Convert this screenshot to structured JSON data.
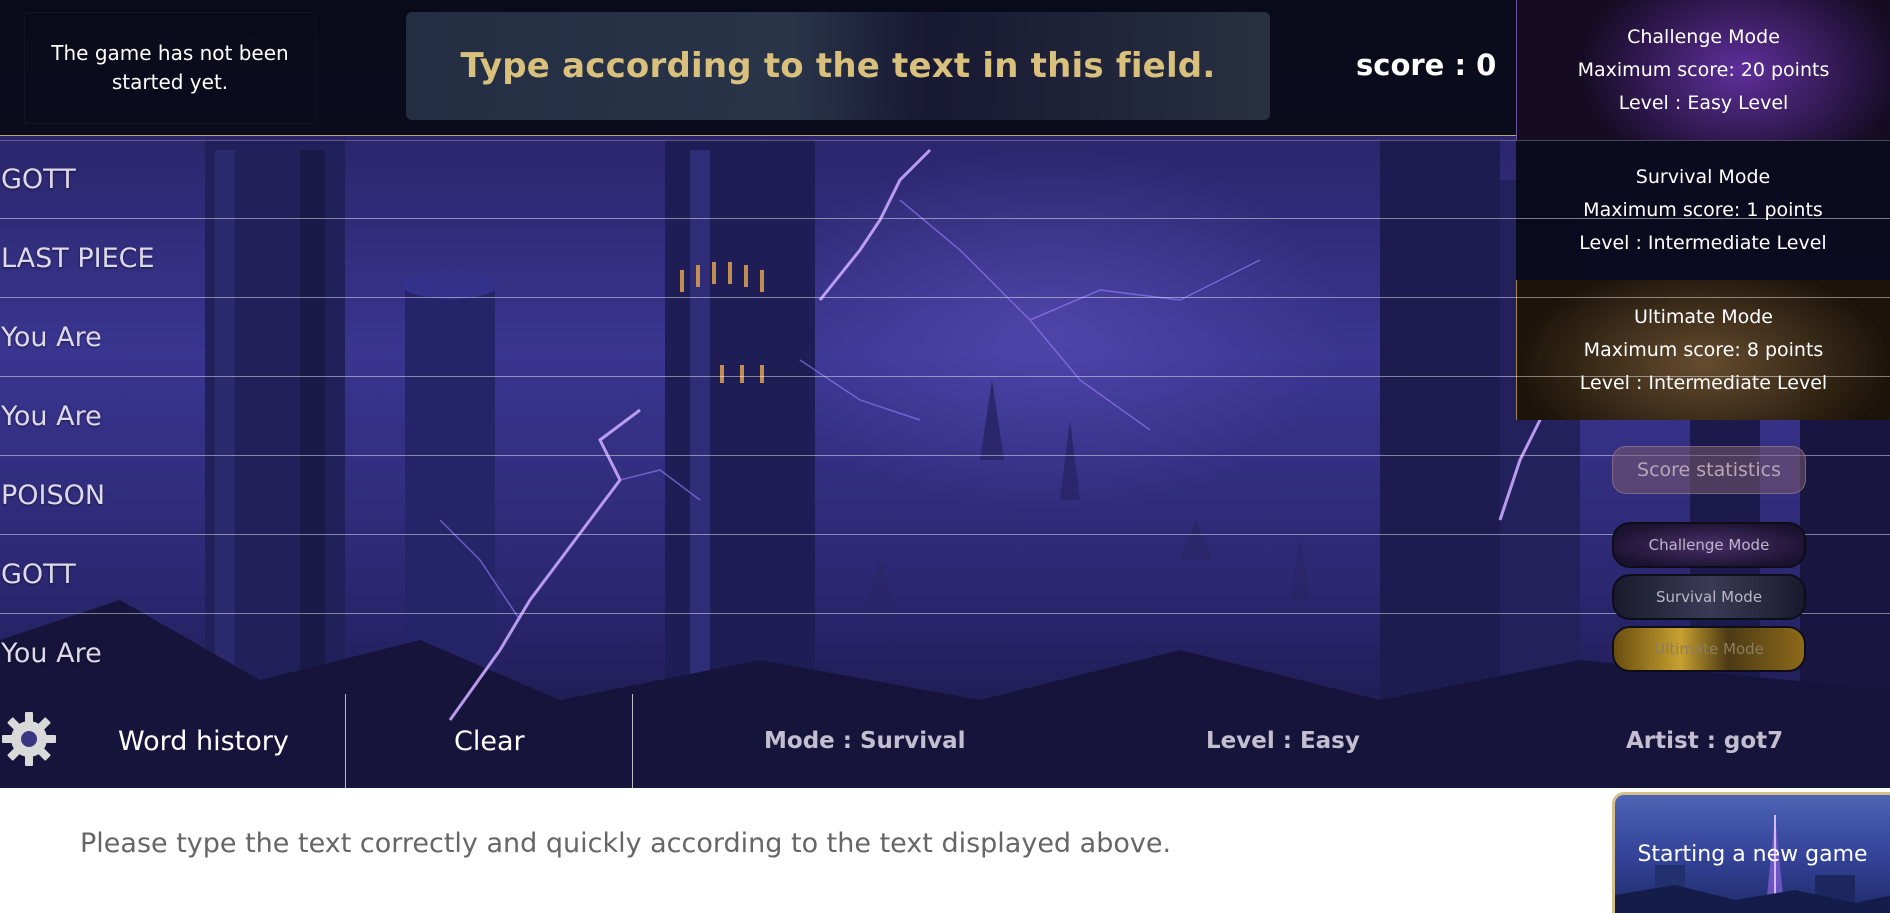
{
  "header": {
    "status_text": "The game has not been started yet.",
    "prompt_text": "Type according to the text in this field.",
    "score_text": "score : 0"
  },
  "mode_cards": [
    {
      "title": "Challenge Mode",
      "max_score": "Maximum score: 20 points",
      "level": "Level : Easy Level"
    },
    {
      "title": "Survival Mode",
      "max_score": "Maximum score: 1 points",
      "level": "Level : Intermediate Level"
    },
    {
      "title": "Ultimate Mode",
      "max_score": "Maximum score: 8 points",
      "level": "Level : Intermediate Level"
    }
  ],
  "side_buttons": {
    "score_statistics": "Score statistics",
    "challenge": "Challenge Mode",
    "survival": "Survival Mode",
    "ultimate": "Ultimate Mode"
  },
  "word_history": [
    "GOTT",
    "LAST PIECE",
    "You Are",
    "You Are",
    "POISON",
    "GOTT",
    "You Are"
  ],
  "controls": {
    "settings_icon": "gear-icon",
    "word_history_label": "Word history",
    "clear_label": "Clear",
    "mode_info": "Mode : Survival",
    "level_info": "Level : Easy",
    "artist_info": "Artist : got7"
  },
  "instruction_text": "Please type the text correctly and quickly according to the text displayed above.",
  "new_game_label": "Starting a new game",
  "colors": {
    "prompt_gold": "#d9c07c",
    "accent_purple": "#b98cff",
    "bar_dark": "#080a16"
  }
}
